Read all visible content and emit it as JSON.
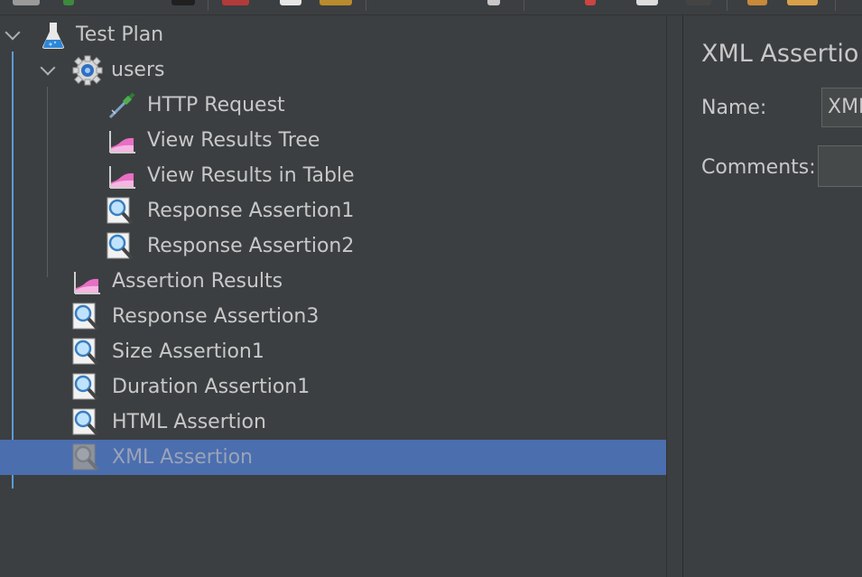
{
  "tree": {
    "items": [
      {
        "label": "Test Plan",
        "icon": "flask-icon"
      },
      {
        "label": "users",
        "icon": "gear-icon"
      },
      {
        "label": "HTTP Request",
        "icon": "pipette-icon"
      },
      {
        "label": "View Results Tree",
        "icon": "graph-listener-icon"
      },
      {
        "label": "View Results in Table",
        "icon": "graph-listener-icon"
      },
      {
        "label": "Response Assertion1",
        "icon": "magnifier-icon"
      },
      {
        "label": "Response Assertion2",
        "icon": "magnifier-icon"
      },
      {
        "label": "Assertion Results",
        "icon": "graph-listener-icon"
      },
      {
        "label": "Response Assertion3",
        "icon": "magnifier-icon"
      },
      {
        "label": "Size Assertion1",
        "icon": "magnifier-icon"
      },
      {
        "label": "Duration Assertion1",
        "icon": "magnifier-icon"
      },
      {
        "label": "HTML Assertion",
        "icon": "magnifier-icon"
      },
      {
        "label": "XML Assertion",
        "icon": "magnifier-icon",
        "selected": true
      }
    ]
  },
  "panel": {
    "title": "XML Assertio",
    "name_label": "Name:",
    "name_value": "XML",
    "comments_label": "Comments:",
    "comments_value": ""
  },
  "colors": {
    "background": "#3c3f41",
    "selection": "#4b6eaf",
    "tree_guide": "#5a9bd8"
  }
}
